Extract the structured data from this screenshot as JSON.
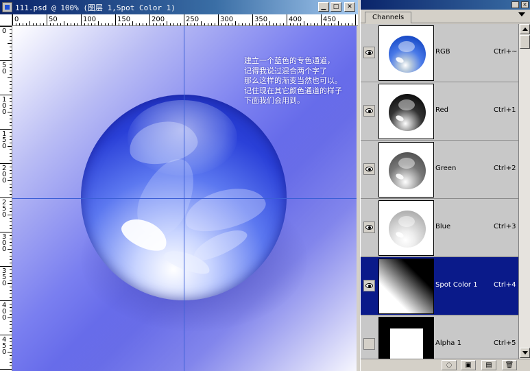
{
  "document": {
    "title": "111.psd @ 100% (图层 1,Spot Color 1)",
    "controls": {
      "minimize": "▁",
      "maximize": "□",
      "close": "✕"
    },
    "ruler_top": [
      "0",
      "50",
      "100",
      "150",
      "200",
      "250",
      "300",
      "350",
      "400",
      "450"
    ],
    "ruler_left": [
      "0",
      "5\n0",
      "1\n0\n0",
      "1\n5\n0",
      "2\n0\n0",
      "2\n5\n0",
      "3\n0\n0",
      "3\n5\n0",
      "4\n0\n0",
      "4\n5\n0"
    ],
    "annotation": [
      "建立一个蓝色的专色通道，",
      "记得我说过混合两个字了",
      "那么这样的渐变当然也可以。",
      "记住现在其它颜色通道的样子",
      "下面我们会用到。"
    ]
  },
  "channels_panel": {
    "tab_label": "Channels",
    "close_glyph": "×",
    "channels": [
      {
        "name": "RGB",
        "shortcut": "Ctrl+~",
        "visible": true,
        "selected": false,
        "thumb": "ball-rgb"
      },
      {
        "name": "Red",
        "shortcut": "Ctrl+1",
        "visible": true,
        "selected": false,
        "thumb": "ball-red"
      },
      {
        "name": "Green",
        "shortcut": "Ctrl+2",
        "visible": true,
        "selected": false,
        "thumb": "ball-green"
      },
      {
        "name": "Blue",
        "shortcut": "Ctrl+3",
        "visible": true,
        "selected": false,
        "thumb": "ball-blue"
      },
      {
        "name": "Spot Color 1",
        "shortcut": "Ctrl+4",
        "visible": true,
        "selected": true,
        "thumb": "spot-gradient"
      },
      {
        "name": "Alpha 1",
        "shortcut": "Ctrl+5",
        "visible": false,
        "selected": false,
        "thumb": "alpha-box"
      }
    ],
    "footer_icons": [
      "load-selection-icon",
      "save-selection-icon",
      "new-channel-icon",
      "trash-icon"
    ],
    "footer_glyphs": [
      "◌",
      "▣",
      "▤",
      "🗑"
    ]
  },
  "colors": {
    "selected_row": "#0a1a8a",
    "titlebar": "#0a246a",
    "guide": "#3b5fd6",
    "canvas_blue": "#5458e4"
  }
}
